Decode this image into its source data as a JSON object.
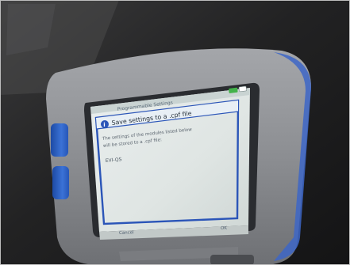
{
  "device": {
    "screen": {
      "app_title": "Programmable Settings",
      "dialog": {
        "title": "Save settings to a .cpf file",
        "body_lines": [
          "The settings of the modules listed below",
          "will be stored to a .cpf file:"
        ],
        "module_name": "EVI-QS"
      },
      "softkeys": {
        "left": "Cancel",
        "right": "OK"
      }
    }
  },
  "colors": {
    "device_bezel": "#8f9195",
    "screen_frame": "#2a2c30",
    "dialog_border": "#2b55b8",
    "side_button": "#2f63c4",
    "background": "#1b1b1c"
  }
}
